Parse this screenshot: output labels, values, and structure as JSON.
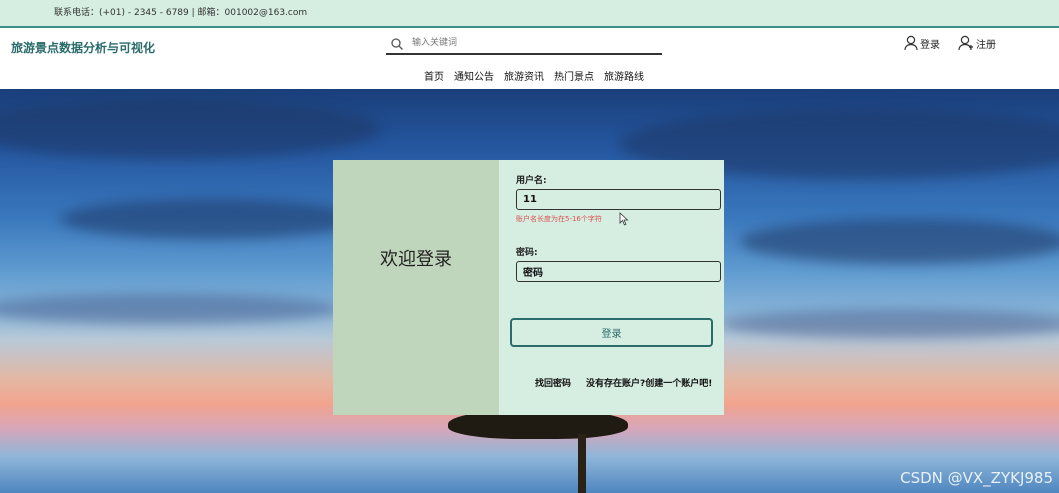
{
  "topbar": {
    "contact": "联系电话：(+01) - 2345 - 6789 | 邮箱：001002@163.com"
  },
  "header": {
    "site_title": "旅游景点数据分析与可视化",
    "search": {
      "placeholder": "输入关键词",
      "value": ""
    },
    "login_label": "登录",
    "register_label": "注册",
    "nav": [
      "首页",
      "通知公告",
      "旅游资讯",
      "热门景点",
      "旅游路线"
    ]
  },
  "login_card": {
    "welcome": "欢迎登录",
    "username_label": "用户名:",
    "username_value": "11",
    "username_error": "账户名长度为在5-16个字符",
    "password_label": "密码:",
    "password_value": "密码",
    "submit_label": "登录",
    "forgot_link": "找回密码",
    "register_link": "没有存在账户?创建一个账户吧!"
  },
  "watermark": "CSDN @VX_ZYKJ985",
  "colors": {
    "accent": "#2a6b6b",
    "topbar_bg": "#d6ede1",
    "card_left": "#c0d6bc",
    "error": "#d9534f"
  }
}
